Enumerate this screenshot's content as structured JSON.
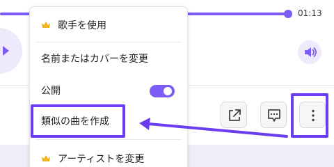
{
  "player": {
    "time": "01:13",
    "progress": 0.86
  },
  "menu": {
    "items": [
      {
        "label": "歌手を使用",
        "icon": "crown-icon"
      },
      {
        "label": "名前またはカバーを変更"
      },
      {
        "label": "公開",
        "toggle_on": true
      },
      {
        "label": "類似の曲を作成"
      },
      {
        "label": "アーティストを変更",
        "icon": "crown-icon"
      }
    ]
  },
  "actions": {
    "share_icon": "share-icon",
    "comment_icon": "comment-icon",
    "more_icon": "more-vertical-icon"
  },
  "colors": {
    "accent": "#7c5cf5",
    "highlight": "#6a3df0",
    "crown": "#f2b620"
  }
}
